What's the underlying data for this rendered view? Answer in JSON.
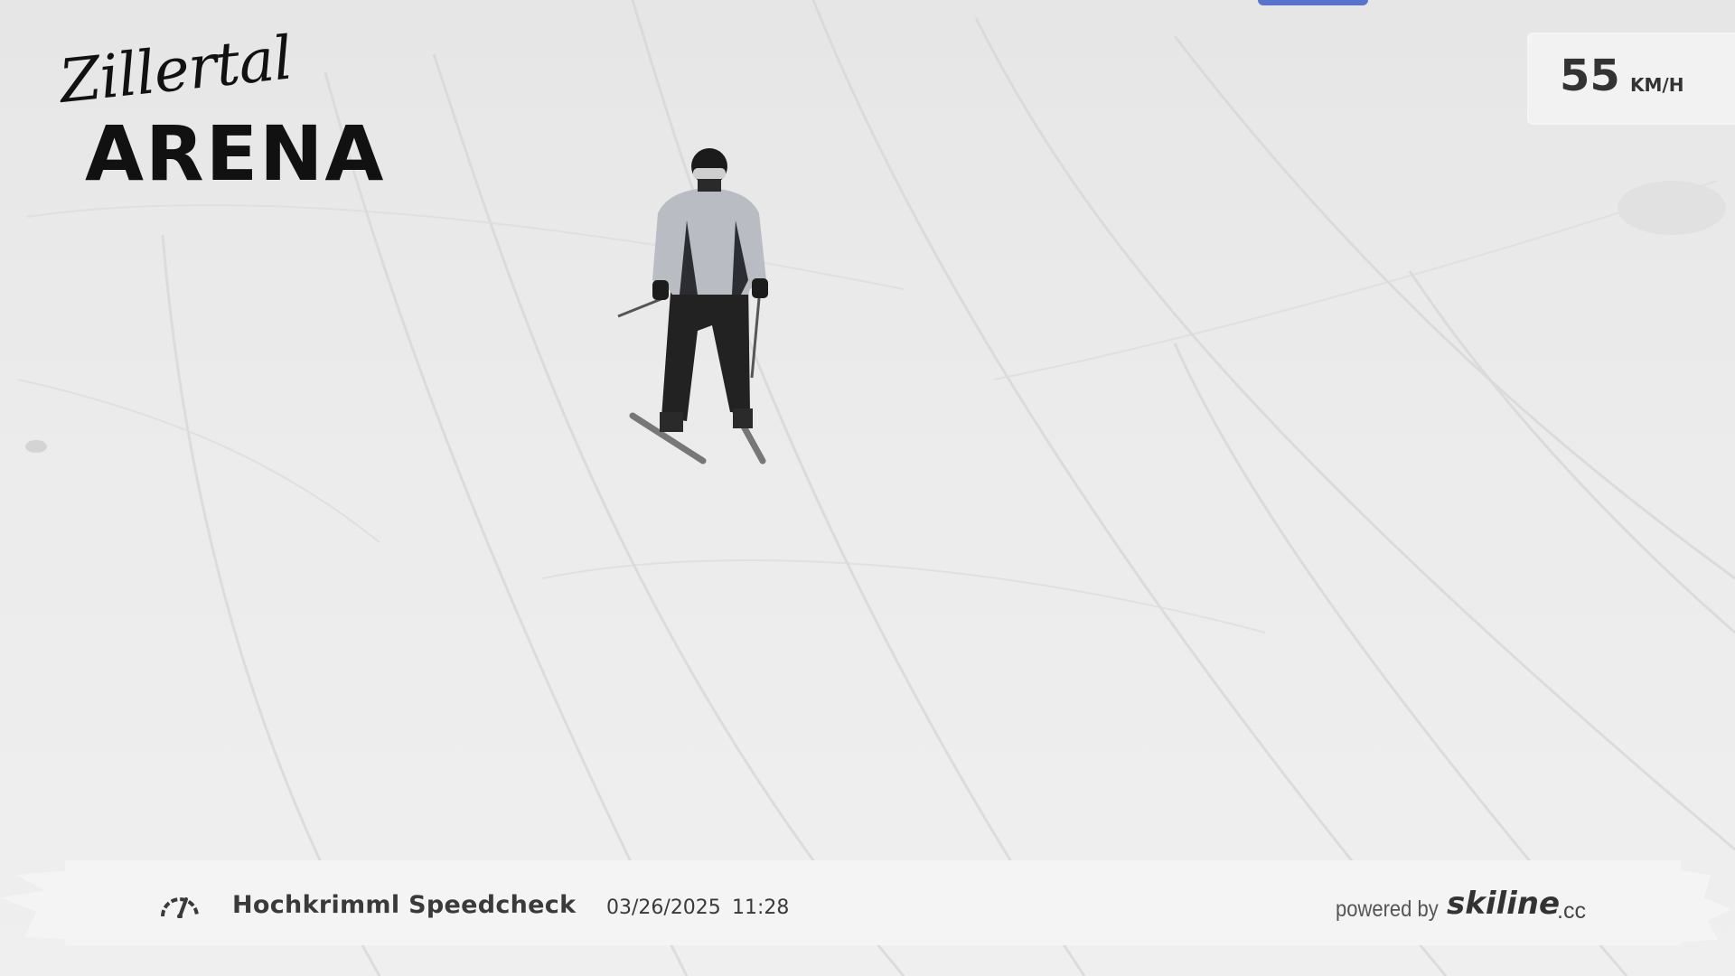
{
  "logo": {
    "script_text": "Zillertal",
    "block_text": "ARENA"
  },
  "speed": {
    "value": "55",
    "unit": "KM/H"
  },
  "info_bar": {
    "gauge_icon": "speedometer-icon",
    "title": "Hochkrimml Speedcheck",
    "date": "03/26/2025",
    "time": "11:28",
    "powered_by": "powered by",
    "brand": "skiline",
    "brand_tld": ".cc"
  },
  "colors": {
    "snow": "#ebebeb",
    "bar": "#f4f4f4",
    "text": "#3a3a3a",
    "logo": "#111111",
    "marker": "#3d5ec9"
  }
}
